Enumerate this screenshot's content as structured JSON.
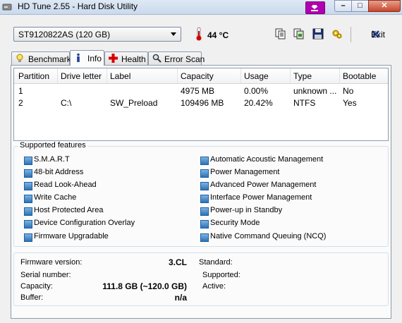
{
  "window": {
    "title": "HD Tune 2.55 - Hard Disk Utility"
  },
  "toolbar": {
    "drive": "ST9120822AS (120 GB)",
    "temperature": "44 °C",
    "exit_label": "Exit"
  },
  "tabs": [
    {
      "label": "Benchmark"
    },
    {
      "label": "Info"
    },
    {
      "label": "Health"
    },
    {
      "label": "Error Scan"
    }
  ],
  "partitions": {
    "columns": [
      "Partition",
      "Drive letter",
      "Label",
      "Capacity",
      "Usage",
      "Type",
      "Bootable"
    ],
    "rows": [
      [
        "1",
        "",
        "",
        "4975 MB",
        "0.00%",
        "unknown ...",
        "No"
      ],
      [
        "2",
        "C:\\",
        "SW_Preload",
        "109496 MB",
        "20.42%",
        "NTFS",
        "Yes"
      ]
    ]
  },
  "features": {
    "title": "Supported features",
    "left": [
      "S.M.A.R.T",
      "48-bit Address",
      "Read Look-Ahead",
      "Write Cache",
      "Host Protected Area",
      "Device Configuration Overlay",
      "Firmware Upgradable"
    ],
    "right": [
      "Automatic Acoustic Management",
      "Power Management",
      "Advanced Power Management",
      "Interface Power Management",
      "Power-up in Standby",
      "Security Mode",
      "Native Command Queuing (NCQ)"
    ],
    "checked_color": "#2e72b5"
  },
  "info": {
    "firmware_label": "Firmware version:",
    "firmware_value": "3.CL",
    "serial_label": "Serial number:",
    "serial_value": "",
    "capacity_label": "Capacity:",
    "capacity_value": "111.8 GB (~120.0 GB)",
    "buffer_label": "Buffer:",
    "buffer_value": "n/a",
    "standard_label": "Standard:",
    "supported_label": "Supported:",
    "active_label": "Active:"
  }
}
